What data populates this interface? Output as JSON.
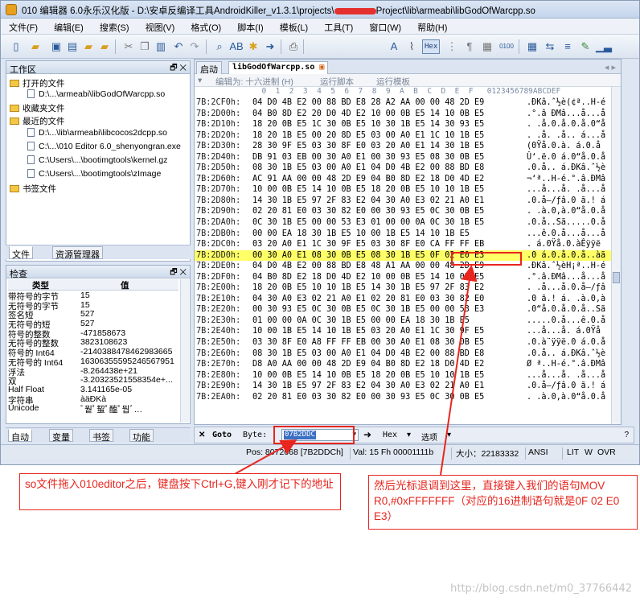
{
  "window": {
    "title_prefix": "010 编辑器 6.0永乐汉化版 - D:\\安卓反编译工具AndroidKiller_v1.3.1\\projects\\",
    "title_suffix": "Project\\lib\\armeabi\\libGodOfWarcpp.so"
  },
  "menu": [
    "文件(F)",
    "编辑(E)",
    "搜索(S)",
    "视图(V)",
    "格式(O)",
    "脚本(I)",
    "模板(L)",
    "工具(T)",
    "窗口(W)",
    "帮助(H)"
  ],
  "toolbar": {
    "hex_label": "Hex"
  },
  "workspace": {
    "title": "工作区",
    "items": [
      {
        "label": "打开的文件",
        "kind": "folder"
      },
      {
        "label": "D:\\...\\armeabi\\libGodOfWarcpp.so",
        "kind": "file"
      },
      {
        "label": "收藏夹文件",
        "kind": "folder"
      },
      {
        "label": "最近的文件",
        "kind": "folder"
      },
      {
        "label": "D:\\...\\lib\\armeabi\\libcocos2dcpp.so",
        "kind": "file"
      },
      {
        "label": "C:\\...\\010 Editor 6.0_shenyongran.exe",
        "kind": "file"
      },
      {
        "label": "C:\\Users\\...\\bootimgtools\\kernel.gz",
        "kind": "file"
      },
      {
        "label": "C:\\Users\\...\\bootimgtools\\zImage",
        "kind": "file"
      },
      {
        "label": "书签文件",
        "kind": "folder"
      }
    ],
    "tabs": [
      "文件",
      "资源管理器"
    ]
  },
  "inspector": {
    "title": "检查",
    "col_type": "类型",
    "col_value": "值",
    "rows": [
      {
        "k": "带符号的字节",
        "v": "15"
      },
      {
        "k": "无符号的字节",
        "v": "15"
      },
      {
        "k": "签名短",
        "v": "527"
      },
      {
        "k": "无符号的短",
        "v": "527"
      },
      {
        "k": "符号的整数",
        "v": "-471858673"
      },
      {
        "k": "无符号的整数",
        "v": "3823108623"
      },
      {
        "k": "符号的 Int64",
        "v": "-2140388478462983665"
      },
      {
        "k": "无符号的 Int64",
        "v": "16306355595246567951"
      },
      {
        "k": "浮法",
        "v": "-8.264438e+21"
      },
      {
        "k": "双",
        "v": "-3.20323521558354e+..."
      },
      {
        "k": "Half Float",
        "v": "3.141165e-05"
      },
      {
        "k": "字符串",
        "v": "àäÐKà"
      },
      {
        "k": "Unicode",
        "v": "ﾞ뭩ﾟ蛪ﾟ醢ﾟ뭡ﾞ…"
      }
    ],
    "tabs": [
      "自动",
      "变量",
      "书签",
      "功能"
    ]
  },
  "editor": {
    "tabs": [
      "启动",
      "libGodOfWarcpp.so"
    ],
    "edit_as": "编辑为: 十六进制 (H)",
    "run_script": "运行脚本",
    "run_template": "运行模板",
    "col_header": "  0  1  2  3  4  5  6  7  8  9  A  B  C  D  E  F   0123456789ABCDEF",
    "rows": [
      {
        "a": "7B:2CF0h:",
        "b": "04 D0 4B E2 00 88 BD E8 28 A2 AA 00 00 48 2D E9",
        "t": ".ÐKâ.ˆ½è(¢ª..H-é"
      },
      {
        "a": "7B:2D00h:",
        "b": "04 B0 8D E2 20 D0 4D E2 10 00 0B E5 14 10 0B E5",
        "t": ".°.â ÐMâ...å...å"
      },
      {
        "a": "7B:2D10h:",
        "b": "18 20 0B E5 1C 30 0B E5 10 30 1B E5 14 30 93 E5",
        "t": ". .å.0.å.0.å.0“å"
      },
      {
        "a": "7B:2D20h:",
        "b": "18 20 1B E5 00 20 8D E5 03 00 A0 E1 1C 10 1B E5",
        "t": ". .å. .å.. á...å"
      },
      {
        "a": "7B:2D30h:",
        "b": "28 30 9F E5 03 30 8F E0 03 20 A0 E1 14 30 1B E5",
        "t": "(0Ÿå.0.à. á.0.å"
      },
      {
        "a": "7B:2D40h:",
        "b": "DB 91 03 EB 00 30 A0 E1 00 30 93 E5 08 30 0B E5",
        "t": "Û‘.ë.0 á.0“å.0.å"
      },
      {
        "a": "7B:2D50h:",
        "b": "08 30 1B E5 03 00 A0 E1 04 D0 4B E2 00 88 BD E8",
        "t": ".0.å.. á.ÐKâ.ˆ½è"
      },
      {
        "a": "7B:2D60h:",
        "b": "AC 91 AA 00 00 48 2D E9 04 B0 8D E2 18 D0 4D E2",
        "t": "¬‘ª..H-é.°.â.ÐMâ"
      },
      {
        "a": "7B:2D70h:",
        "b": "10 00 0B E5 14 10 0B E5 18 20 0B E5 10 10 1B E5",
        "t": "...å...å. .å...å"
      },
      {
        "a": "7B:2D80h:",
        "b": "14 30 1B E5 97 2F 83 E2 04 30 A0 E3 02 21 A0 E1",
        "t": ".0.å—/ƒâ.0 ã.! á"
      },
      {
        "a": "7B:2D90h:",
        "b": "02 20 81 E0 03 30 82 E0 00 30 93 E5 0C 30 0B E5",
        "t": ". .à.0‚à.0“å.0.å"
      },
      {
        "a": "7B:2DA0h:",
        "b": "0C 30 1B E5 00 00 53 E3 01 00 00 0A 0C 30 1B E5",
        "t": ".0.å..Sã.....0.å"
      },
      {
        "a": "7B:2DB0h:",
        "b": "00 00 EA 18 30 1B E5 10 00 1B E5 14 10 1B E5",
        "t": "...ê.0.å...å...å"
      },
      {
        "a": "7B:2DC0h:",
        "b": "03 20 A0 E1 1C 30 9F E5 03 30 8F E0 CA FF FF EB",
        "t": ". á.0Ÿå.0.àÊÿÿë"
      },
      {
        "a": "7B:2DD0h:",
        "b": "00 30 A0 E1 08 30 0B E5 08 30 1B E5 0F 02 E0 E3",
        "t": ".0 á.0.å.0.å..àã",
        "hl": true
      },
      {
        "a": "7B:2DE0h:",
        "b": "04 D0 4B E2 00 88 BD E8 48 A1 AA 00 00 48 2D E9",
        "t": ".ÐKâ.ˆ½èH¡ª..H-é"
      },
      {
        "a": "7B:2DF0h:",
        "b": "04 B0 8D E2 18 D0 4D E2 10 00 0B E5 14 10 0B E5",
        "t": ".°.â.ÐMâ...å...å"
      },
      {
        "a": "7B:2E00h:",
        "b": "18 20 0B E5 10 10 1B E5 14 30 1B E5 97 2F 83 E2",
        "t": ". .å...å.0.å—/ƒâ"
      },
      {
        "a": "7B:2E10h:",
        "b": "04 30 A0 E3 02 21 A0 E1 02 20 81 E0 03 30 82 E0",
        "t": ".0 ã.! á. .à.0‚à"
      },
      {
        "a": "7B:2E20h:",
        "b": "00 30 93 E5 0C 30 0B E5 0C 30 1B E5 00 00 53 E3",
        "t": ".0“å.0.å.0.å..Sã"
      },
      {
        "a": "7B:2E30h:",
        "b": "01 00 00 0A 0C 30 1B E5 00 00 EA 18 30 1B E5",
        "t": ".....0.å...ê.0.å"
      },
      {
        "a": "7B:2E40h:",
        "b": "10 00 1B E5 14 10 1B E5 03 20 A0 E1 1C 30 9F E5",
        "t": "...å...å. á.0Ÿå"
      },
      {
        "a": "7B:2E50h:",
        "b": "03 30 8F E0 A8 FF FF EB 00 30 A0 E1 08 30 0B E5",
        "t": ".0.à¨ÿÿë.0 á.0.å"
      },
      {
        "a": "7B:2E60h:",
        "b": "08 30 1B E5 03 00 A0 E1 04 D0 4B E2 00 88 BD E8",
        "t": ".0.å.. á.ÐKâ.ˆ½è"
      },
      {
        "a": "7B:2E70h:",
        "b": "D8 A0 AA 00 00 48 2D E9 04 B0 8D E2 18 D0 4D E2",
        "t": "Ø ª..H-é.°.â.ÐMâ"
      },
      {
        "a": "7B:2E80h:",
        "b": "10 00 0B E5 14 10 0B E5 18 20 0B E5 10 10 1B E5",
        "t": "...å...å. .å...å"
      },
      {
        "a": "7B:2E90h:",
        "b": "14 30 1B E5 97 2F 83 E2 04 30 A0 E3 02 21 A0 E1",
        "t": ".0.å—/ƒâ.0 ã.! á"
      },
      {
        "a": "7B:2EA0h:",
        "b": "02 20 81 E0 03 30 82 E0 00 30 93 E5 0C 30 0B E5",
        "t": ". .à.0‚à.0“å.0.å"
      }
    ]
  },
  "findbar": {
    "goto": "Goto",
    "byte": "Byte:",
    "value": "07B2DDC",
    "hex": "Hex",
    "options": "选项"
  },
  "status": {
    "pos": "Pos: 8072668 [7B2DDCh]",
    "val": "Val: 15 Fh 00001111b",
    "size": "大小：22183332",
    "enc": "ANSI",
    "lit": "LIT",
    "w": "W",
    "ovr": "OVR"
  },
  "notes": {
    "left": "so文件拖入010editor之后，键盘按下Ctrl+G,键入刚才记下的地址",
    "right": "然后光标退调到这里，直接键入我们的语句MOV  R0,#0xFFFFFFF（对应的16进制语句就是0F 02 E0 E3）"
  },
  "watermark": "http://blog.csdn.net/m0_37766442",
  "colors": {
    "annotation": "#e8261f",
    "highlight": "#ffff66"
  }
}
